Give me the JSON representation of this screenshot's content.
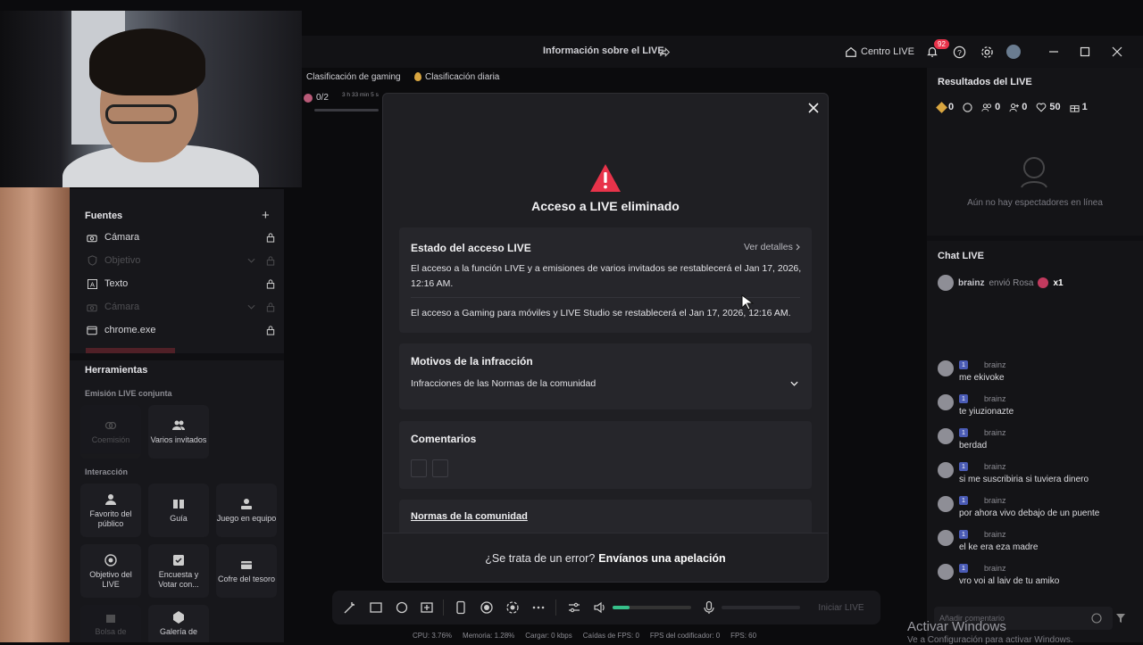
{
  "topbar": {
    "title": "Información sobre el LIVE",
    "live_center": "Centro LIVE",
    "notif_count": "92"
  },
  "chips": {
    "gaming": "Clasificación de gaming",
    "daily": "Clasificación diaria"
  },
  "goal": {
    "count": "0/2",
    "timer": "3 h 33 min 5 s"
  },
  "sources": {
    "title": "Fuentes",
    "items": [
      {
        "label": "Cámara",
        "icon": "camera-icon",
        "dim": false
      },
      {
        "label": "Objetivo",
        "icon": "shield-icon",
        "dim": true
      },
      {
        "label": "Texto",
        "icon": "text-icon",
        "dim": false
      },
      {
        "label": "Cámara",
        "icon": "camera-icon",
        "dim": true
      },
      {
        "label": "chrome.exe",
        "icon": "window-icon",
        "dim": false
      }
    ]
  },
  "tools": {
    "title": "Herramientas",
    "cohost_section": "Emisión LIVE conjunta",
    "cohost": "Coemisión",
    "multi_guest": "Varios invitados",
    "interaction_section": "Interacción",
    "fan_favorite": "Favorito del público",
    "guide": "Guía",
    "team_game": "Juego en equipo",
    "live_goal": "Objetivo del LIVE",
    "poll": "Encuesta y Votar con...",
    "treasure": "Cofre del tesoro",
    "bag": "Bolsa de",
    "gallery": "Galería de"
  },
  "results": {
    "title": "Resultados del LIVE",
    "stats": [
      "0",
      "0",
      "0",
      "50",
      "1"
    ],
    "no_viewers": "Aún no hay espectadores en línea"
  },
  "chat": {
    "title": "Chat LIVE",
    "gift_user": "brainz",
    "gift_text": "envió Rosa",
    "gift_qty": "x1",
    "badge_level": "1",
    "messages": [
      {
        "name": "brainz",
        "text": "me ekivoke"
      },
      {
        "name": "brainz",
        "text": "te yiuzionazte"
      },
      {
        "name": "brainz",
        "text": "berdad"
      },
      {
        "name": "brainz",
        "text": "si me suscribiria si tuviera dinero"
      },
      {
        "name": "brainz",
        "text": "por ahora vivo debajo de un puente"
      },
      {
        "name": "brainz",
        "text": "el ke era eza madre"
      },
      {
        "name": "brainz",
        "text": "vro voi al laiv de tu amiko"
      }
    ],
    "input_placeholder": "Añadir comentario"
  },
  "bottom": {
    "start_live": "Iniciar LIVE",
    "volume_level": 0.22
  },
  "stats_bar": [
    "CPU: 3.76%",
    "Memoria: 1.28%",
    "Cargar: 0 kbps",
    "Caídas de FPS: 0",
    "FPS del codificador: 0",
    "FPS: 60"
  ],
  "modal": {
    "title": "Acceso a LIVE eliminado",
    "status_title": "Estado del acceso LIVE",
    "view_details": "Ver detalles",
    "status_p1": "El acceso a la función LIVE y a emisiones de varios invitados se restablecerá el Jan 17, 2026, 12:16 AM.",
    "status_p2": "El acceso a Gaming para móviles y LIVE Studio se restablecerá el Jan 17, 2026, 12:16 AM.",
    "reasons_title": "Motivos de la infracción",
    "reasons_value": "Infracciones de las Normas de la comunidad",
    "comments_title": "Comentarios",
    "rules_link": "Normas de la comunidad",
    "footer_question": "¿Se trata de un error?",
    "footer_link": "Envíanos una apelación"
  },
  "watermark": {
    "line1": "Activar Windows",
    "line2": "Ve a Configuración para activar Windows."
  },
  "colors": {
    "accent": "#e8334a",
    "progress": "#36c08a",
    "warning": "#e8334a"
  }
}
